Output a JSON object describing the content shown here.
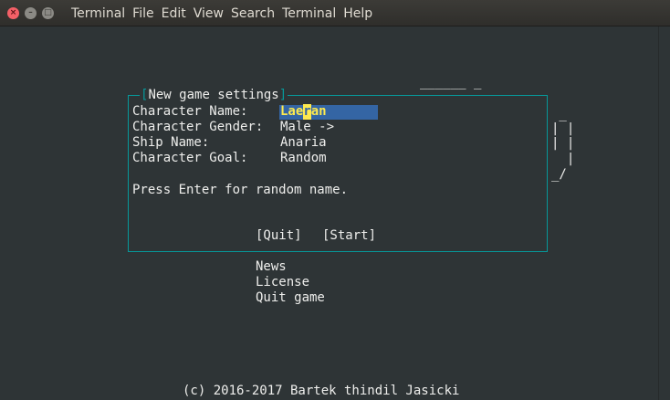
{
  "window": {
    "title": "Terminal",
    "menu": [
      "Terminal",
      "File",
      "Edit",
      "View",
      "Search",
      "Terminal",
      "Help"
    ],
    "buttons": {
      "close": "×",
      "minimize": "–",
      "maximize": "□"
    }
  },
  "ascii_art": {
    "underline_left": "______",
    "underline_right": "______ _",
    "right_lines": [
      " _",
      "| |",
      "| |",
      "  |",
      "_/"
    ]
  },
  "dialog": {
    "title_open": "[",
    "title": "New game settings",
    "title_close": "]",
    "fields": [
      {
        "label": "Character Name:",
        "value": "Laeran"
      },
      {
        "label": "Character Gender:",
        "value": "Male ->"
      },
      {
        "label": "Ship Name:",
        "value": "Anaria"
      },
      {
        "label": "Character Goal:",
        "value": "Random"
      }
    ],
    "name_parts": {
      "before": "Lae",
      "cursor": "r",
      "after": "an"
    },
    "hint": "Press Enter for random name.",
    "quit": "[Quit]",
    "start": "[Start]"
  },
  "main_menu": [
    "News",
    "License",
    "Quit game"
  ],
  "footer": "(c) 2016-2017 Bartek thindil Jasicki",
  "colors": {
    "background": "#2e3436",
    "text": "#eeeeec",
    "border": "#06989a",
    "field_bg": "#3465a4",
    "field_text": "#fce94f"
  }
}
